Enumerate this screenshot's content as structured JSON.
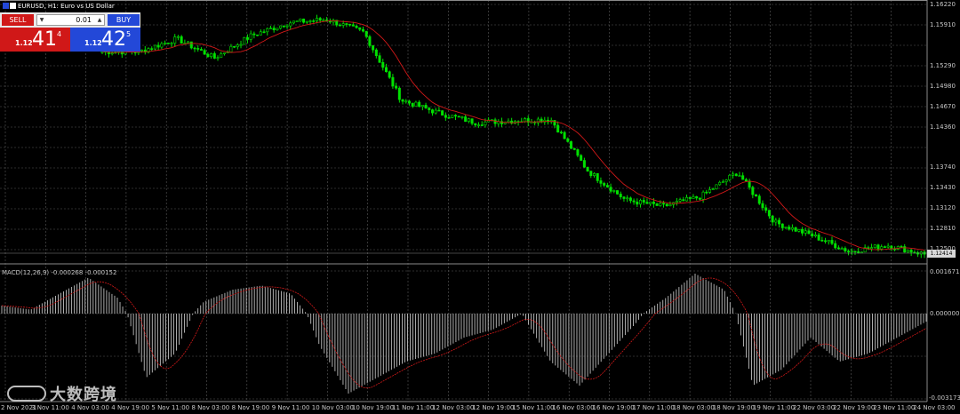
{
  "window": {
    "title": "EURUSD, H1: Euro vs US Dollar"
  },
  "trade_panel": {
    "sell_label": "SELL",
    "buy_label": "BUY",
    "lot_value": "0.01",
    "sell_prefix": "1.12",
    "sell_big": "41",
    "sell_sup": "4",
    "buy_prefix": "1.12",
    "buy_big": "42",
    "buy_sup": "5",
    "sell_color": "#d01818",
    "buy_color": "#2348d8"
  },
  "price_axis": {
    "labels": [
      "1.16220",
      "1.15910",
      "1.15290",
      "1.14980",
      "1.14670",
      "1.14360",
      "1.13740",
      "1.13430",
      "1.13120",
      "1.12810",
      "1.12500"
    ],
    "current_price": "1.12414"
  },
  "macd_axis": {
    "labels": [
      "0.001671",
      "0.000000",
      "-0.003173"
    ]
  },
  "macd_indicator": {
    "label": "MACD(12,26,9) -0.000268 -0.000152"
  },
  "time_axis": {
    "labels": [
      "2 Nov 2021",
      "3 Nov 11:00",
      "4 Nov 03:00",
      "4 Nov 19:00",
      "5 Nov 11:00",
      "8 Nov 03:00",
      "8 Nov 19:00",
      "9 Nov 11:00",
      "10 Nov 03:00",
      "10 Nov 19:00",
      "11 Nov 11:00",
      "12 Nov 03:00",
      "12 Nov 19:00",
      "15 Nov 11:00",
      "16 Nov 03:00",
      "16 Nov 19:00",
      "17 Nov 11:00",
      "18 Nov 03:00",
      "18 Nov 19:00",
      "19 Nov 11:00",
      "22 Nov 03:00",
      "22 Nov 19:00",
      "23 Nov 11:00",
      "24 Nov 03:00"
    ]
  },
  "watermark": {
    "text": "大数跨境"
  },
  "colors": {
    "candle_bull": "#00e000",
    "ma_line": "#d01818",
    "grid": "#5a5a5a",
    "histogram": "#bfbfbf",
    "signal": "#d01818"
  },
  "chart_data": {
    "type": "line",
    "symbol": "EURUSD",
    "timeframe": "H1",
    "price_ylim": [
      1.1226,
      1.1635
    ],
    "price_series_approx": [
      {
        "x": "3 Nov 11:00",
        "y": 1.1555
      },
      {
        "x": "4 Nov 03:00",
        "y": 1.1555
      },
      {
        "x": "4 Nov 19:00",
        "y": 1.1575
      },
      {
        "x": "5 Nov 11:00",
        "y": 1.1545
      },
      {
        "x": "8 Nov 03:00",
        "y": 1.158
      },
      {
        "x": "8 Nov 19:00",
        "y": 1.16
      },
      {
        "x": "9 Nov 11:00",
        "y": 1.1605
      },
      {
        "x": "10 Nov 03:00",
        "y": 1.1585
      },
      {
        "x": "10 Nov 19:00",
        "y": 1.148
      },
      {
        "x": "11 Nov 11:00",
        "y": 1.146
      },
      {
        "x": "12 Nov 03:00",
        "y": 1.1445
      },
      {
        "x": "12 Nov 19:00",
        "y": 1.1448
      },
      {
        "x": "15 Nov 11:00",
        "y": 1.145
      },
      {
        "x": "16 Nov 03:00",
        "y": 1.137
      },
      {
        "x": "16 Nov 19:00",
        "y": 1.1325
      },
      {
        "x": "17 Nov 11:00",
        "y": 1.1315
      },
      {
        "x": "18 Nov 03:00",
        "y": 1.133
      },
      {
        "x": "18 Nov 19:00",
        "y": 1.1368
      },
      {
        "x": "19 Nov 11:00",
        "y": 1.129
      },
      {
        "x": "22 Nov 03:00",
        "y": 1.127
      },
      {
        "x": "22 Nov 19:00",
        "y": 1.1245
      },
      {
        "x": "23 Nov 11:00",
        "y": 1.1255
      },
      {
        "x": "24 Nov 03:00",
        "y": 1.1241
      }
    ],
    "macd_ylim": [
      -0.003173,
      0.001671
    ]
  }
}
